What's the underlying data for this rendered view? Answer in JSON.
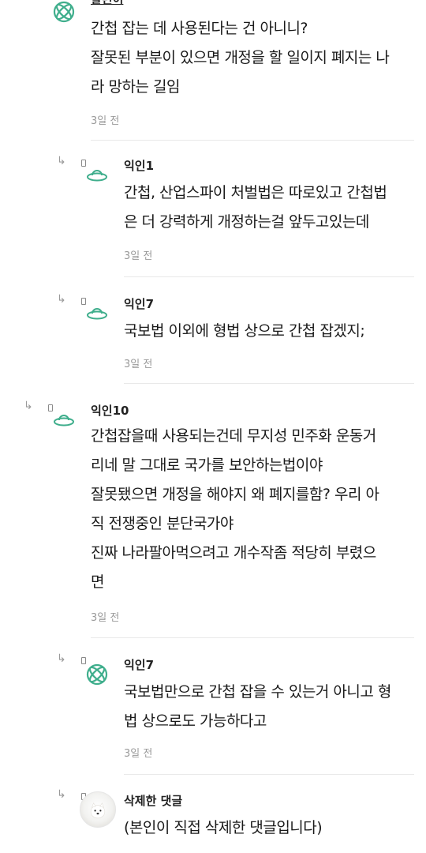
{
  "comments": [
    {
      "author": "말린이",
      "lines": [
        "간첩 잡는 데 사용된다는 건 아니니?",
        "잘못된 부분이 있으면 개정을 할 일이지 폐지는 나",
        "라 망하는 길임"
      ],
      "time": "3일 전",
      "avatar_icon": "atom-icon"
    },
    {
      "author": "익인1",
      "lines": [
        "간첩, 산업스파이 처벌법은 따로있고 간첩법",
        "은 더 강력하게 개정하는걸 앞두고있는데"
      ],
      "time": "3일 전",
      "avatar_icon": "ufo-icon"
    },
    {
      "author": "익인7",
      "lines": [
        "국보법 이외에 형법 상으로 간첩 잡겠지;"
      ],
      "time": "3일 전",
      "avatar_icon": "ufo-icon"
    },
    {
      "author": "익인10",
      "lines": [
        "간첩잡을때 사용되는건데 무지성 민주화 운동거",
        "리네 말 그대로 국가를 보안하는법이야",
        "잘못됐으면 개정을 해야지 왜 폐지를함? 우리 아",
        "직 전쟁중인 분단국가야",
        "진짜 나라팔아먹으려고 개수작좀 적당히 부렸으",
        "면"
      ],
      "time": "3일 전",
      "avatar_icon": "ufo-icon"
    },
    {
      "author": "익인7",
      "lines": [
        "국보법만으로 간첩 잡을 수 있는거 아니고 형",
        "법 상으로도 가능하다고"
      ],
      "time": "3일 전",
      "avatar_icon": "atom-icon"
    },
    {
      "author": "삭제한 댓글",
      "lines": [
        "(본인이 직접 삭제한 댓글입니다)"
      ],
      "time": "",
      "avatar_icon": "dog-photo-avatar"
    }
  ],
  "reply_marker": "↳",
  "colors": {
    "icon_green": "#3fae8c",
    "time_gray": "#9a9a9a",
    "divider": "#e9e9e9"
  }
}
